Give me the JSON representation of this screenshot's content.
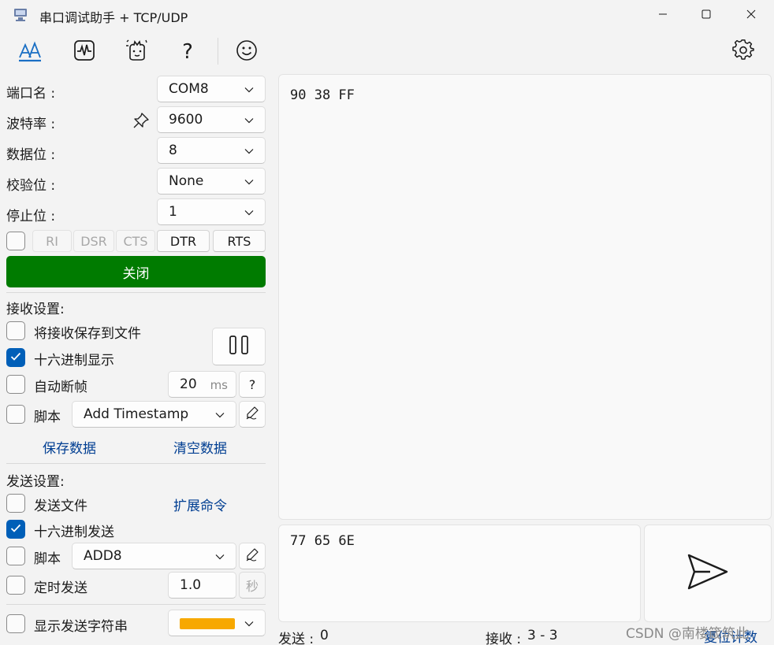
{
  "window": {
    "title": "串口调试助手 + TCP/UDP",
    "icons": [
      "app-icon",
      "minimize-icon",
      "maximize-icon",
      "close-icon"
    ]
  },
  "toolbar": {
    "icons": [
      "font-icon",
      "waveform-icon",
      "plugin-icon",
      "help-icon",
      "smiley-icon",
      "settings-icon"
    ],
    "help_glyph": "?"
  },
  "serial": {
    "port_label": "端口名 :",
    "port_value": "COM8",
    "baud_label": "波特率 :",
    "baud_value": "9600",
    "databits_label": "数据位 :",
    "databits_value": "8",
    "parity_label": "校验位 :",
    "parity_value": "None",
    "stopbits_label": "停止位 :",
    "stopbits_value": "1",
    "pins": [
      "RI",
      "DSR",
      "CTS",
      "DTR",
      "RTS"
    ],
    "close_label": "关闭",
    "accent_color": "#007b00"
  },
  "receive": {
    "section_label": "接收设置:",
    "save_to_file_label": "将接收保存到文件",
    "save_to_file_checked": false,
    "hex_display_label": "十六进制显示",
    "hex_display_checked": true,
    "auto_frame_label": "自动断帧",
    "auto_frame_checked": false,
    "frame_value": "20",
    "frame_unit": "ms",
    "help_label": "?",
    "script_label": "脚本",
    "script_checked": false,
    "script_value": "Add Timestamp",
    "save_data_label": "保存数据",
    "clear_data_label": "清空数据",
    "output_text": "90 38 FF"
  },
  "send": {
    "section_label": "发送设置:",
    "send_file_label": "发送文件",
    "send_file_checked": false,
    "ext_cmd_label": "扩展命令",
    "hex_send_label": "十六进制发送",
    "hex_send_checked": true,
    "script_label": "脚本",
    "script_checked": false,
    "script_value": "ADD8",
    "timed_label": "定时发送",
    "timed_checked": false,
    "timed_value": "1.0",
    "timed_unit": "秒",
    "show_string_label": "显示发送字符串",
    "show_string_checked": false,
    "color_value": "#f7a800",
    "input_text": "77 65 6E"
  },
  "statusbar": {
    "sent_label": "发送 :",
    "sent_value": "0",
    "recv_label": "接收 :",
    "recv_value": "3 - 3",
    "reset_label": "复位计数"
  },
  "watermark": "CSDN @南楼箴筑此",
  "accent_color": "#005fb8",
  "link_color": "#003e92"
}
